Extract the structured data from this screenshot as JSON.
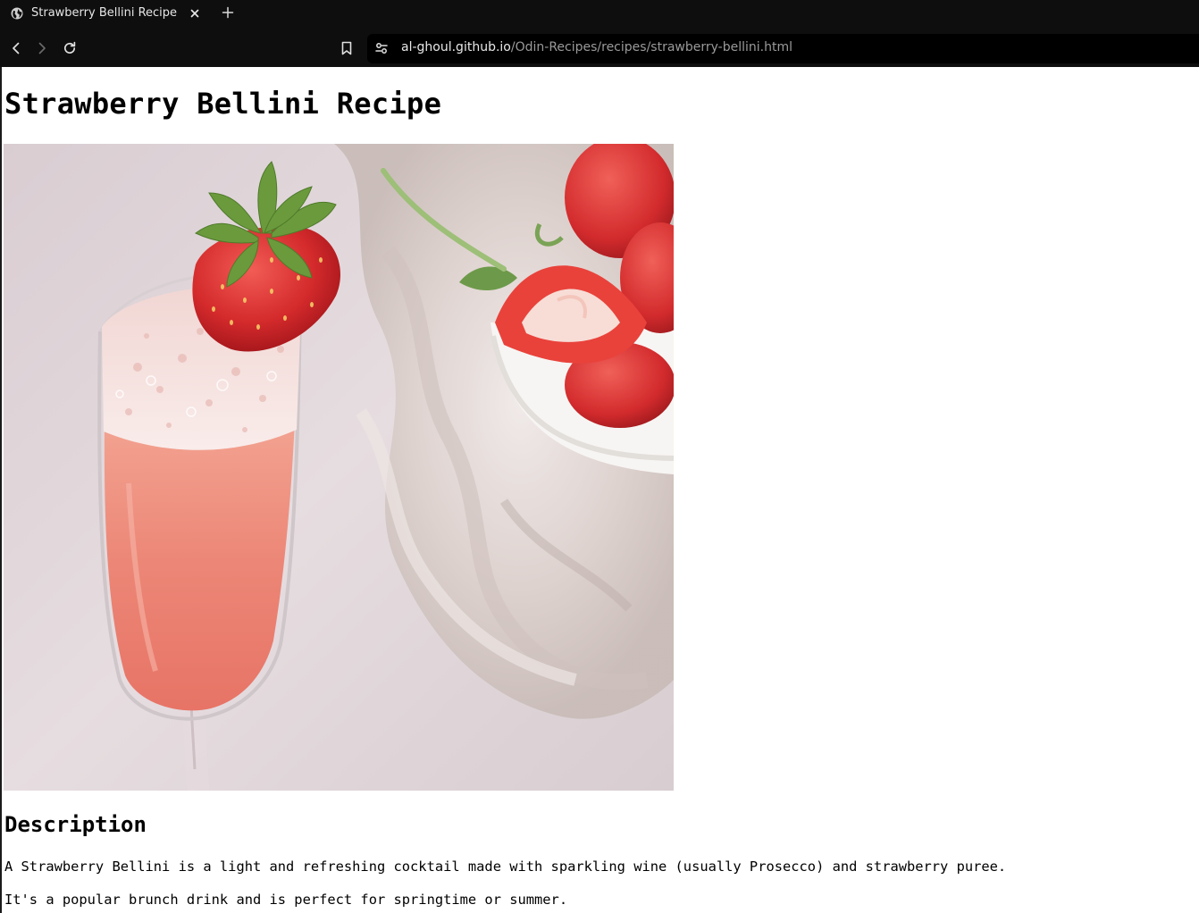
{
  "browser": {
    "tab": {
      "title": "Strawberry Bellini Recipe",
      "favicon": "globe-icon"
    },
    "toolbar": {
      "back": "chevron-left-icon",
      "forward": "chevron-right-icon",
      "reload": "reload-icon",
      "bookmark": "bookmark-icon",
      "site_info": "tune-icon"
    },
    "address_bar": {
      "host": "al-ghoul.github.io",
      "path": "/Odin-Recipes/recipes/strawberry-bellini.html"
    }
  },
  "page": {
    "title": "Strawberry Bellini Recipe",
    "hero_image": {
      "alt": "Strawberry Bellini"
    },
    "description": {
      "heading": "Description",
      "paragraphs": [
        "A Strawberry Bellini is a light and refreshing cocktail made with sparkling wine (usually Prosecco) and strawberry puree.",
        "It's a popular brunch drink and is perfect for springtime or summer."
      ]
    }
  },
  "colors": {
    "chrome_bg": "#0e0e0e",
    "omnibox_bg": "#000000",
    "url_host": "#e8e8e8",
    "url_path": "#9a9a9a",
    "page_bg": "#ffffff"
  }
}
